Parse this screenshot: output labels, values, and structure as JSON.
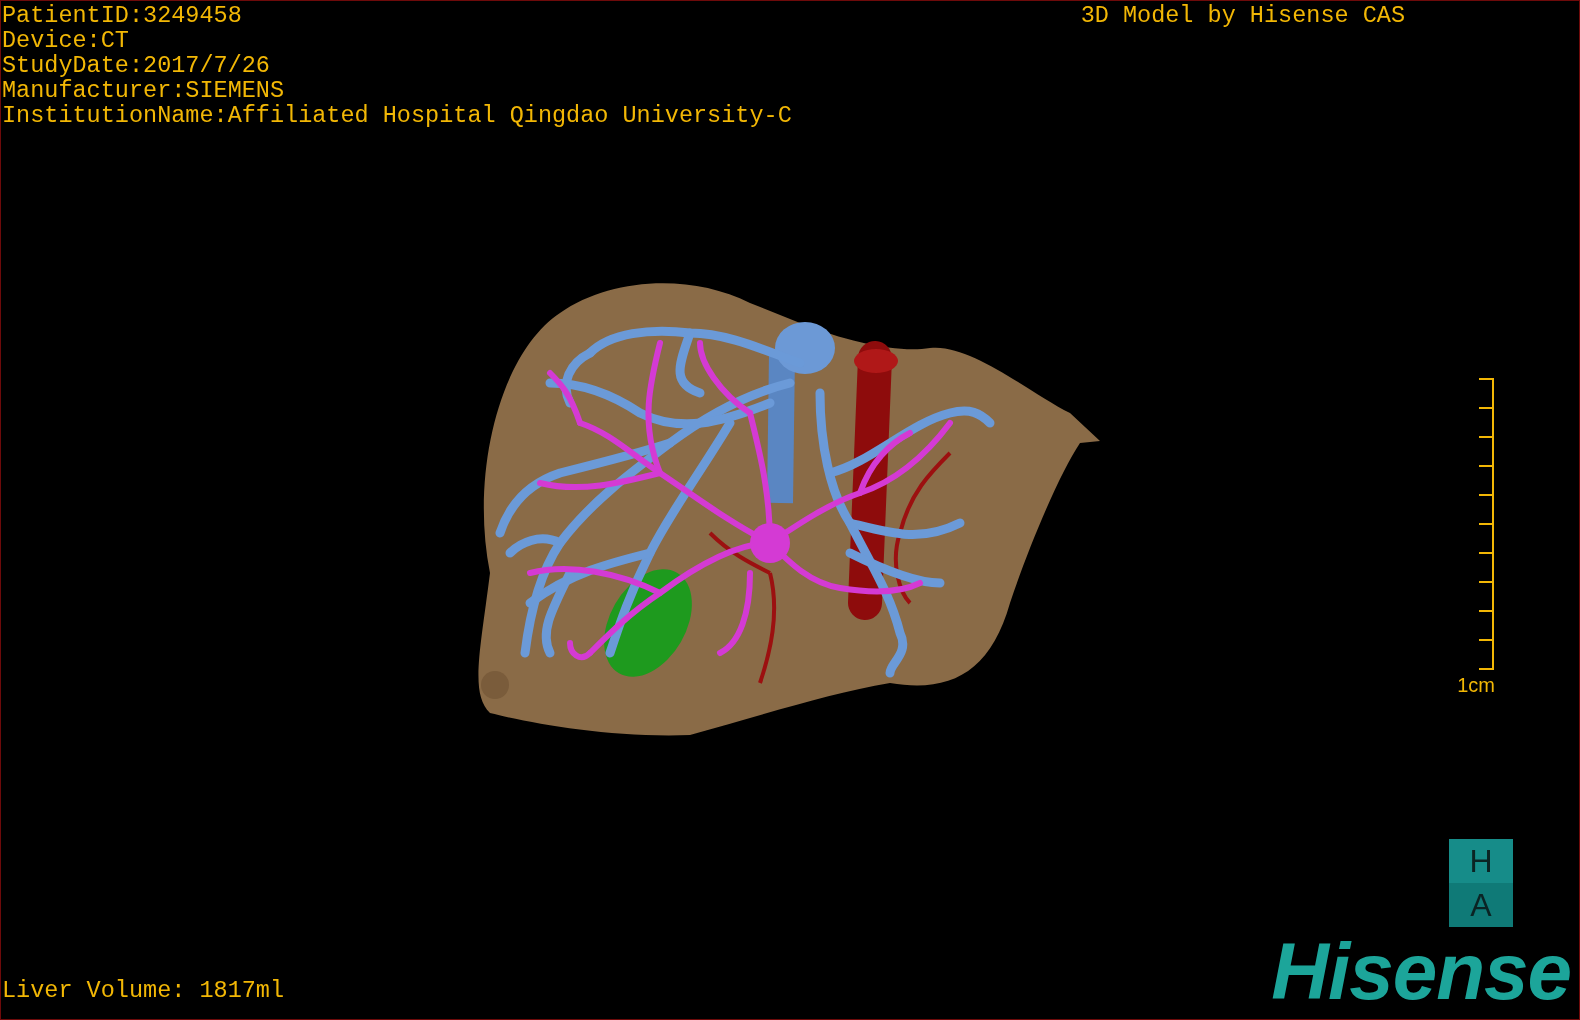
{
  "info_lines": [
    "PatientID:3249458",
    "Device:CT",
    "StudyDate:2017/7/26",
    "Manufacturer:SIEMENS",
    "InstitutionName:Affiliated Hospital Qingdao University-C"
  ],
  "header_title": "3D Model by Hisense CAS",
  "scale_label": "1cm",
  "liver_volume": "Liver Volume: 1817ml",
  "logo": {
    "badge": [
      "H",
      "A"
    ],
    "wordmark": "Hisense"
  }
}
